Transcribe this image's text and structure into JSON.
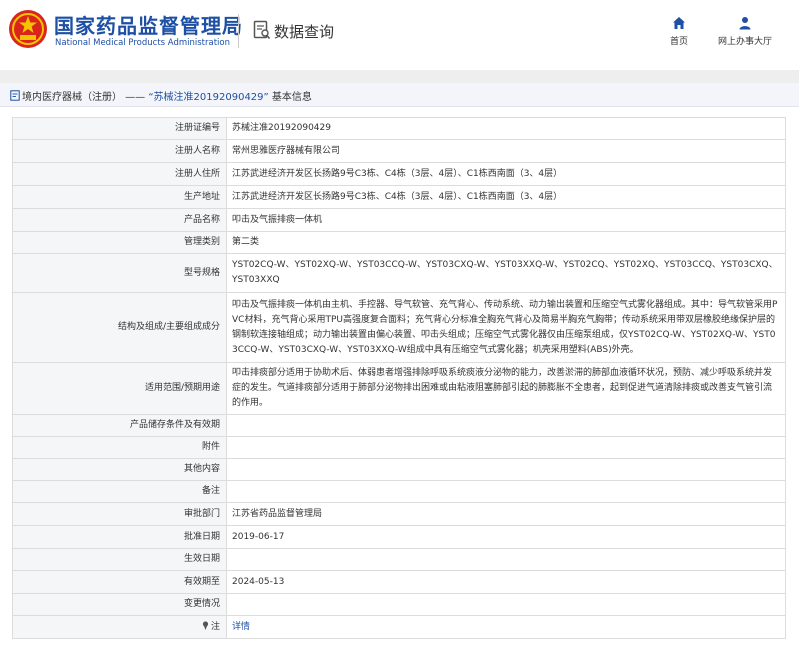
{
  "header": {
    "brand_cn": "国家药品监督管理局",
    "brand_en": "National Medical Products Administration",
    "logo_icon": "national-emblem-icon",
    "query_icon": "document-search-icon",
    "query_title": "数据查询",
    "nav": [
      {
        "icon": "home-icon",
        "label": "首页"
      },
      {
        "icon": "user-icon",
        "label": "网上办事大厅"
      }
    ],
    "brand_color": "#1d4fa5"
  },
  "breadcrumb": {
    "prefix": "境内医疗器械（注册） —— ",
    "highlight": "“苏械注准20192090429”",
    "suffix": " 基本信息"
  },
  "rows": [
    {
      "label": "注册证编号",
      "value": "苏械注准20192090429"
    },
    {
      "label": "注册人名称",
      "value": "常州思雅医疗器械有限公司"
    },
    {
      "label": "注册人住所",
      "value": "江苏武进经济开发区长扬路9号C3栋、C4栋（3层、4层）、C1栋西南面（3、4层）"
    },
    {
      "label": "生产地址",
      "value": "江苏武进经济开发区长扬路9号C3栋、C4栋（3层、4层）、C1栋西南面（3、4层）"
    },
    {
      "label": "产品名称",
      "value": "叩击及气振排痰一体机"
    },
    {
      "label": "管理类别",
      "value": "第二类"
    },
    {
      "label": "型号规格",
      "value": "YST02CQ-W、YST02XQ-W、YST03CCQ-W、YST03CXQ-W、YST03XXQ-W、YST02CQ、YST02XQ、YST03CCQ、YST03CXQ、YST03XXQ"
    },
    {
      "label": "结构及组成/主要组成成分",
      "value": "叩击及气振排痰一体机由主机、手控器、导气软管、充气背心、传动系统、动力输出装置和压缩空气式雾化器组成。其中：导气软管采用PVC材料，充气背心采用TPU高强度复合面料；充气背心分标准全胸充气背心及简易半胸充气胸带；传动系统采用带双层橡胶绝缘保护层的钢制软连接轴组成；动力输出装置由偏心装置、叩击头组成；压缩空气式雾化器仅由压缩泵组成，仅YST02CQ-W、YST02XQ-W、YST03CCQ-W、YST03CXQ-W、YST03XXQ-W组成中具有压缩空气式雾化器；机壳采用塑料(ABS)外壳。"
    },
    {
      "label": "适用范围/预期用途",
      "value": "叩击排痰部分适用于协助术后、体弱患者增强排除呼吸系统痰液分泌物的能力，改善淤滞的肺部血液循环状况，预防、减少呼吸系统并发症的发生。气道排痰部分适用于肺部分泌物排出困难或由粘液阻塞肺部引起的肺膨胀不全患者，起到促进气道清除排痰或改善支气管引流的作用。"
    },
    {
      "label": "产品储存条件及有效期",
      "value": ""
    },
    {
      "label": "附件",
      "value": ""
    },
    {
      "label": "其他内容",
      "value": ""
    },
    {
      "label": "备注",
      "value": ""
    },
    {
      "label": "审批部门",
      "value": "江苏省药品监督管理局"
    },
    {
      "label": "批准日期",
      "value": "2019-06-17"
    },
    {
      "label": "生效日期",
      "value": ""
    },
    {
      "label": "有效期至",
      "value": "2024-05-13"
    },
    {
      "label": "变更情况",
      "value": ""
    }
  ],
  "note": {
    "icon": "pin-icon",
    "label": "注",
    "link": "详情"
  }
}
